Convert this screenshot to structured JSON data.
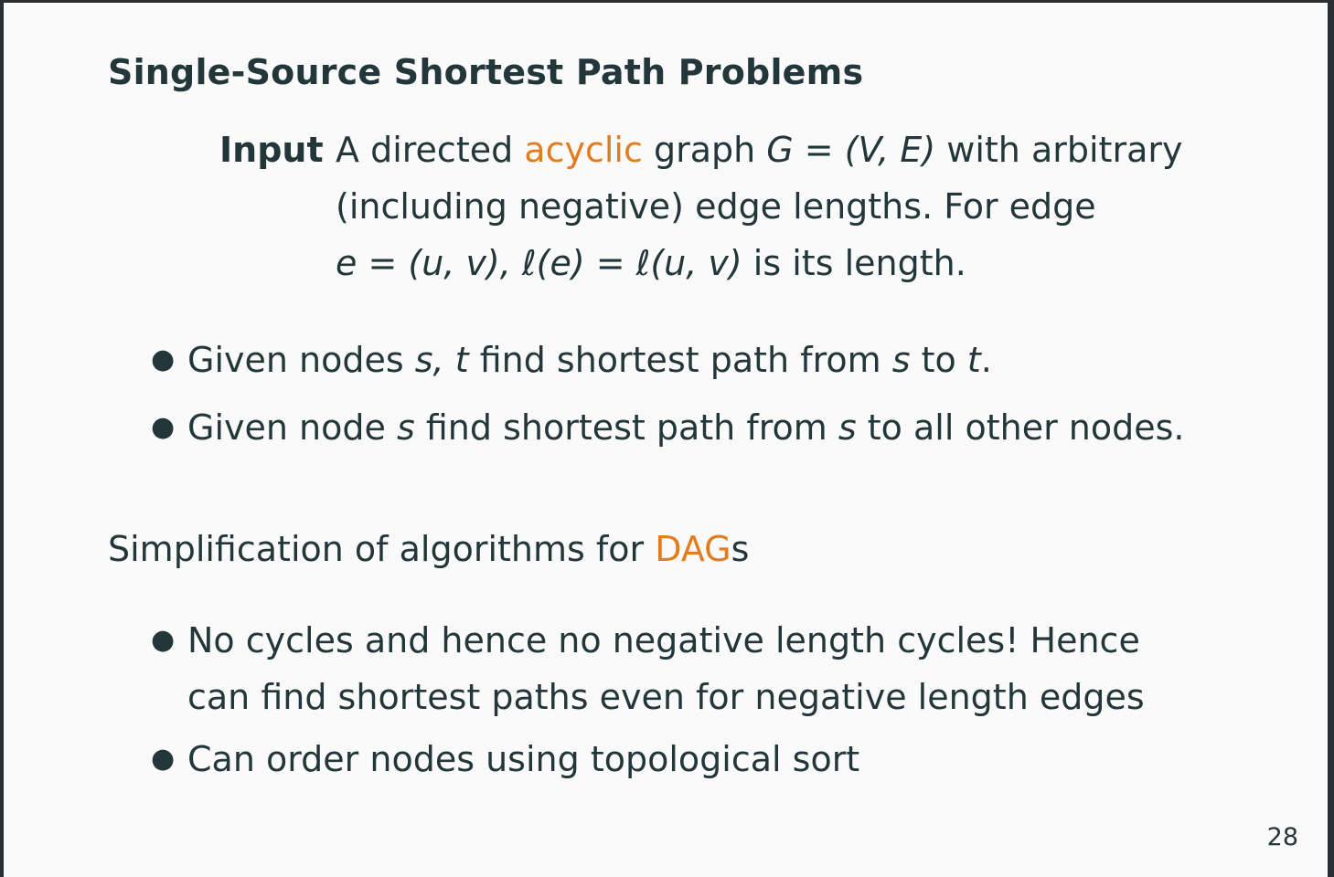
{
  "slide": {
    "title": "Single-Source Shortest Path Problems",
    "input": {
      "label": "Input",
      "line1_a": "A directed ",
      "line1_accent": "acyclic",
      "line1_b": " graph ",
      "line1_math": "G = (V, E)",
      "line1_c": " with arbitrary",
      "line2": "(including negative) edge lengths.  For edge",
      "line3_math": "e = (u, v), ℓ(e) = ℓ(u, v)",
      "line3_c": " is its length."
    },
    "problems": [
      {
        "a": "Given nodes ",
        "m1": "s, t",
        "b": " find shortest path from ",
        "m2": "s",
        "c": " to ",
        "m3": "t",
        "d": "."
      },
      {
        "a": "Given node ",
        "m1": "s",
        "b": " find shortest path from ",
        "m2": "s",
        "c": " to all other nodes."
      }
    ],
    "simplification": {
      "text": "Simplification of algorithms for ",
      "accent": "DAG",
      "suffix": "s"
    },
    "dag_points": [
      "No cycles and hence no negative length cycles!  Hence can find shortest paths even for negative length edges",
      "Can order nodes using topological sort"
    ],
    "bullet_symbol": "●",
    "page_number": "28",
    "colors": {
      "text": "#23373b",
      "accent": "#e17d1f",
      "background": "#fafafa"
    }
  }
}
